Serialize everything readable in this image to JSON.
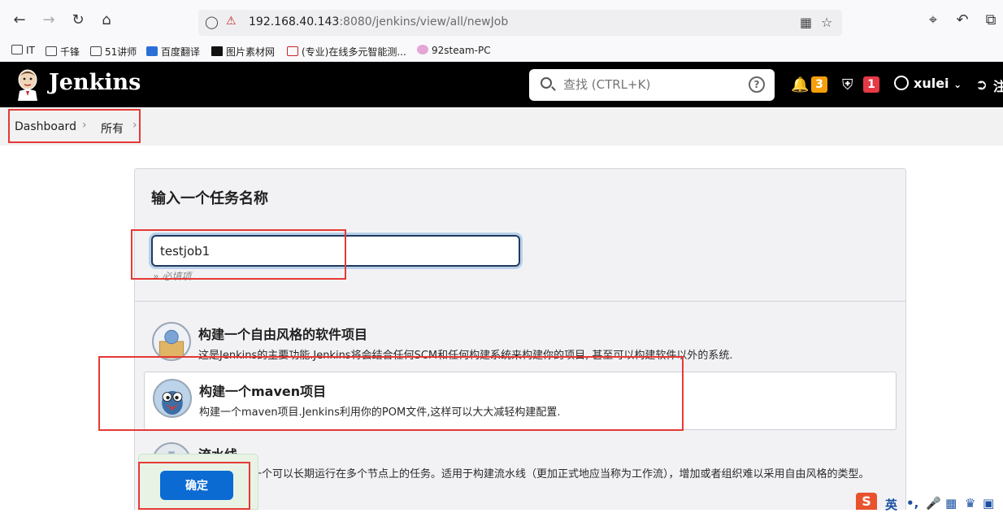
{
  "browser": {
    "url_host": "192.168.40.143",
    "url_rest": ":8080/jenkins/view/all/newJob",
    "bookmarks": [
      "IT",
      "千锋",
      "51讲师",
      "百度翻译",
      "图片素材网",
      "(专业)在线多元智能测...",
      "92steam-PC"
    ]
  },
  "header": {
    "title": "Jenkins",
    "search_placeholder": "查找 (CTRL+K)",
    "notifications_count": "3",
    "security_count": "1",
    "user": "xulei",
    "logout_partial": "注"
  },
  "breadcrumb": [
    "Dashboard",
    "所有"
  ],
  "form": {
    "title": "输入一个任务名称",
    "name_value": "testjob1",
    "required": "» 必填项"
  },
  "job_types": [
    {
      "title": "构建一个自由风格的软件项目",
      "desc": "这是Jenkins的主要功能.Jenkins将会结合任何SCM和任何构建系统来构建你的项目, 甚至可以构建软件以外的系统."
    },
    {
      "title": "构建一个maven项目",
      "desc": "构建一个maven项目.Jenkins利用你的POM文件,这样可以大大减轻构建配置."
    },
    {
      "title": "流水线",
      "desc": "精心地组织一个可以长期运行在多个节点上的任务。适用于构建流水线（更加正式地应当称为工作流），增加或者组织难以采用自由风格的类型。"
    }
  ],
  "ok_button": "确定",
  "ime": {
    "mode": "英"
  },
  "colors": {
    "accent": "#0b6bd3",
    "annotation": "#e53935",
    "badge_warning": "#f59e0b",
    "badge_danger": "#e53945"
  }
}
